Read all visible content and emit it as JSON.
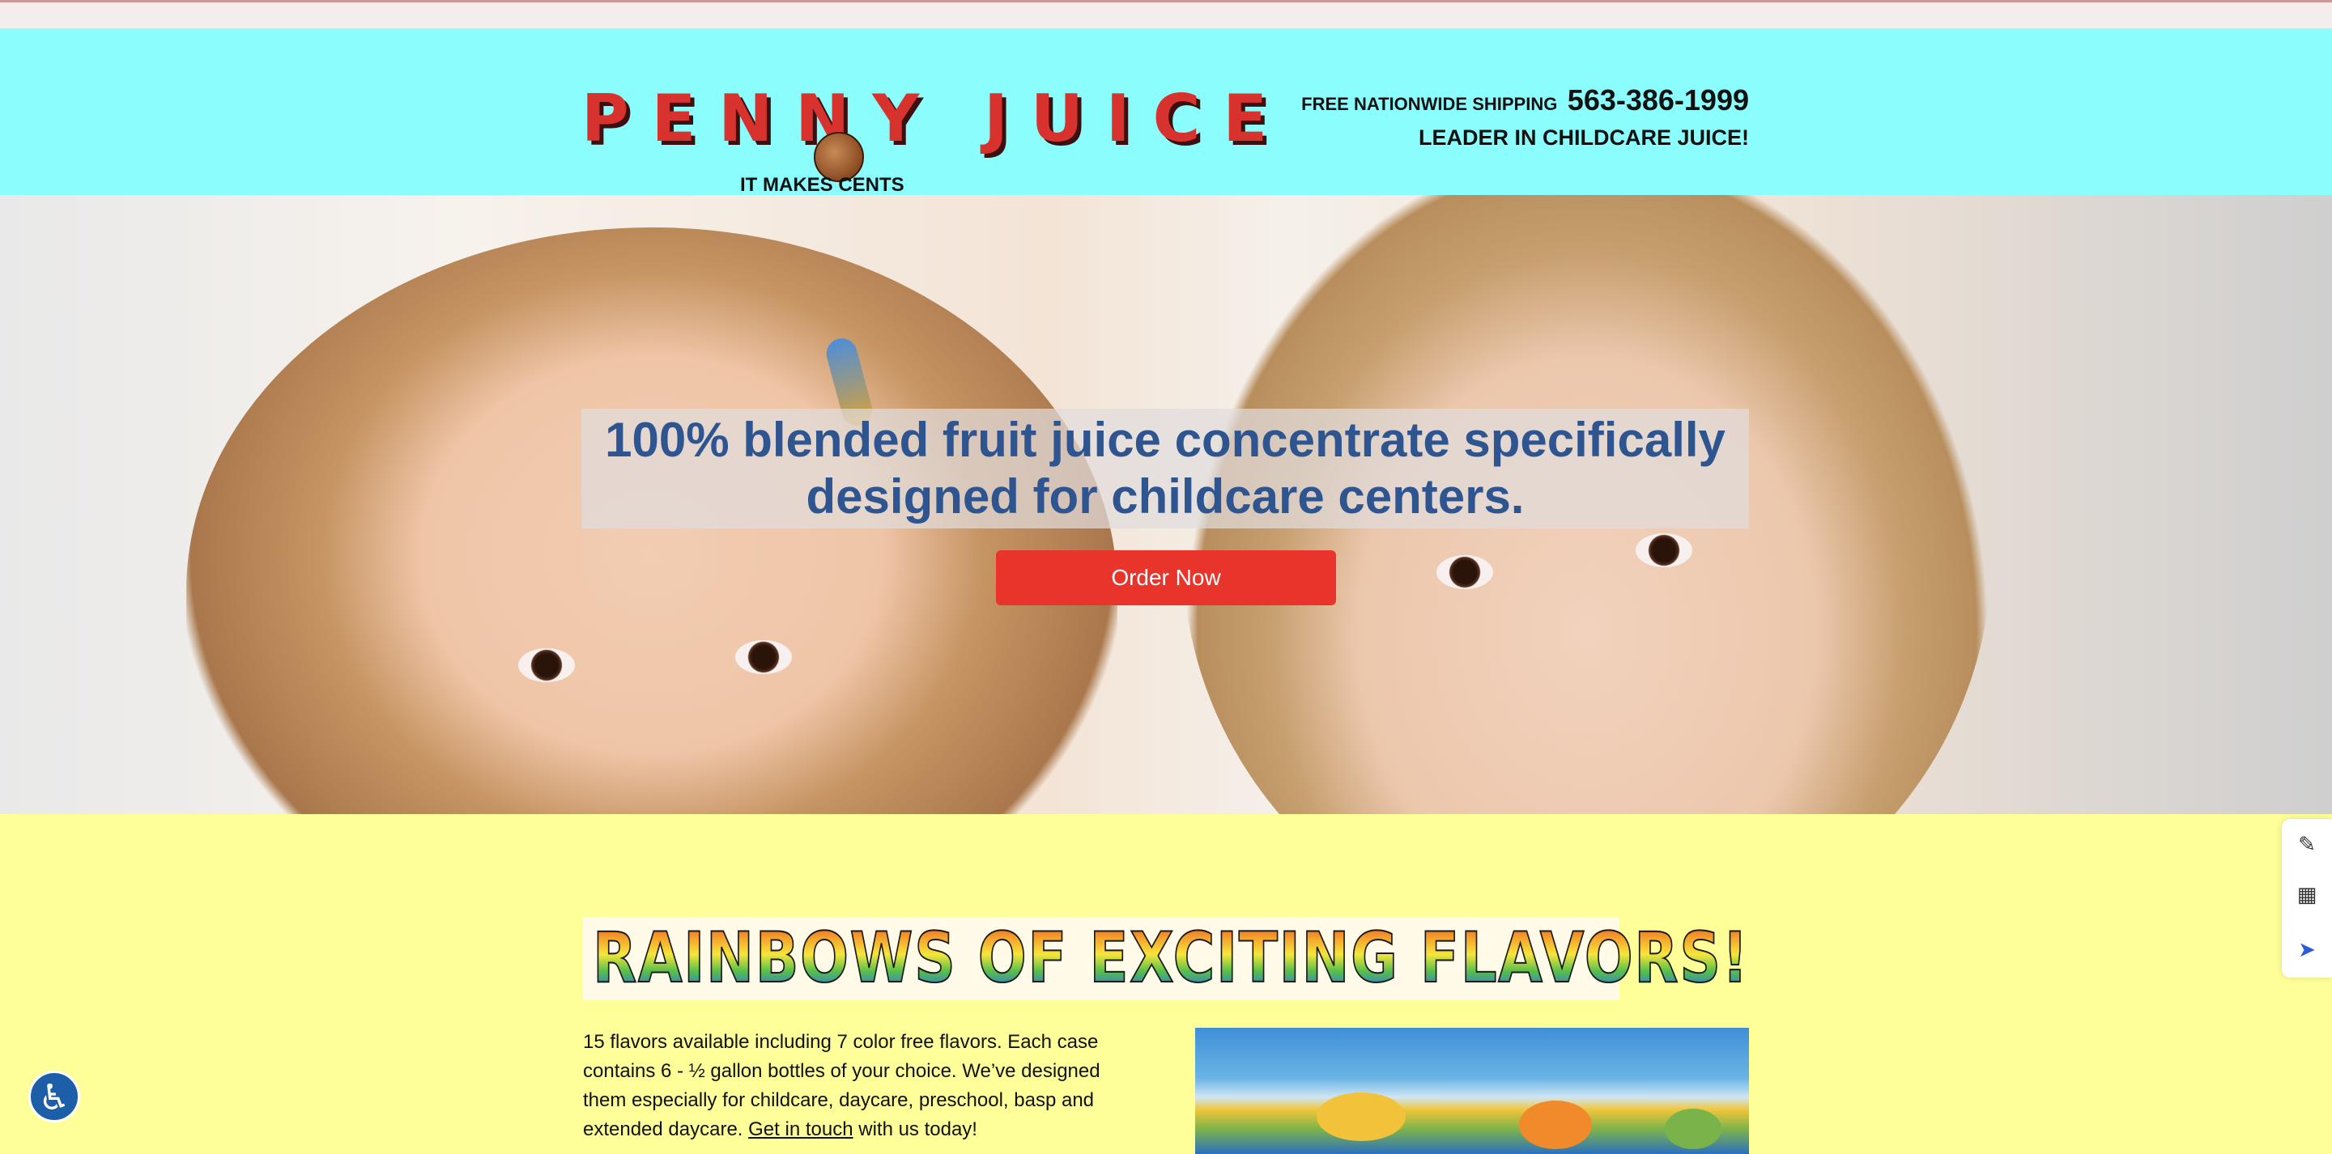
{
  "header": {
    "logo_text": "PENNY JUICE",
    "logo_left": "PENNY",
    "logo_right": "JUICE",
    "tagline": "IT MAKES CENTS",
    "shipping_label": "FREE NATIONWIDE SHIPPING",
    "phone": "563-386-1999",
    "leader": "LEADER IN CHILDCARE JUICE!"
  },
  "hero": {
    "title": "100% blended fruit juice concentrate specifically designed for childcare centers.",
    "cta": "Order Now"
  },
  "flavors": {
    "banner": "RAINBOWS OF EXCITING FLAVORS!",
    "body_before_link": "15 flavors available including 7 color free flavors. Each case contains 6 - ½ gallon bottles of your choice. We’ve designed them especially for childcare, daycare, preschool, basp and extended daycare. ",
    "link": "Get in touch",
    "body_after_link": " with us today!"
  },
  "side_tools": [
    "edit-icon",
    "calendar-icon",
    "rocket-icon"
  ],
  "accessibility": {
    "icon": "accessibility-icon"
  },
  "colors": {
    "header_bg": "#8cfdfd",
    "page_bg": "#ffff99",
    "hero_title": "#2f5591",
    "cta_bg": "#e8342a",
    "logo_red": "#d8322e"
  }
}
